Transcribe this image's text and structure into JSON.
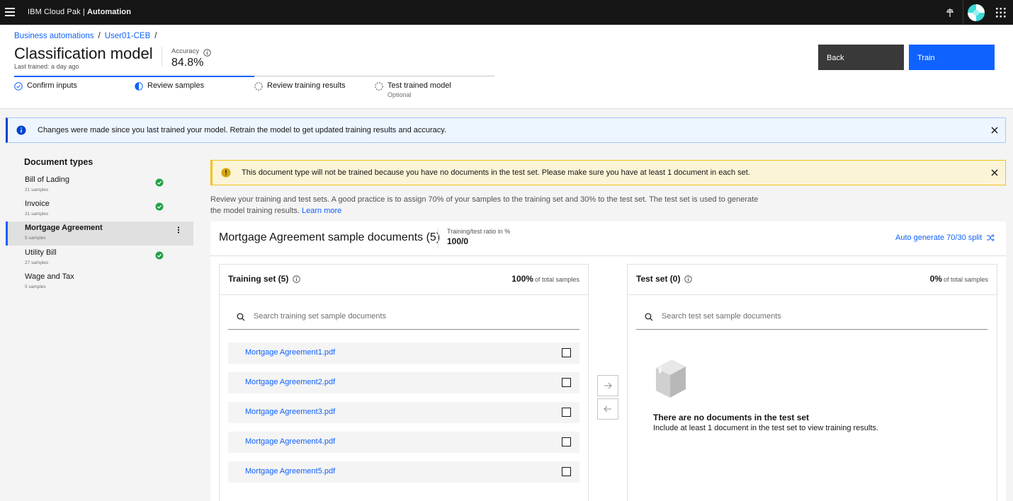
{
  "topbar": {
    "brand_prefix": "IBM Cloud Pak | ",
    "brand_product": "Automation",
    "icons": [
      "menu-icon",
      "pin-icon",
      "avatar",
      "app-switcher-icon"
    ]
  },
  "header": {
    "breadcrumbs": [
      "Business automations",
      "User01-CEB"
    ],
    "title": "Classification model",
    "last_trained": "Last trained: a day ago",
    "accuracy_label": "Accuracy",
    "accuracy_value": "84.8%",
    "steps": [
      {
        "label": "Confirm inputs",
        "state": "complete"
      },
      {
        "label": "Review samples",
        "state": "current"
      },
      {
        "label": "Review training results",
        "state": "incomplete"
      },
      {
        "label": "Test trained model",
        "state": "incomplete",
        "sub": "Optional"
      }
    ],
    "progress_fraction": 0.5,
    "back_label": "Back",
    "train_label": "Train"
  },
  "notice": {
    "text": "Changes were made since you last trained your model. Retrain the model to get updated training results and accuracy."
  },
  "sidebar": {
    "title": "Document types",
    "items": [
      {
        "name": "Bill of Lading",
        "count": "21 samples",
        "complete": true
      },
      {
        "name": "Invoice",
        "count": "31 samples",
        "complete": true
      },
      {
        "name": "Mortgage Agreement",
        "count": "5 samples",
        "complete": false,
        "active": true
      },
      {
        "name": "Utility Bill",
        "count": "27 samples",
        "complete": true
      },
      {
        "name": "Wage and Tax",
        "count": "5 samples",
        "complete": false
      }
    ]
  },
  "warning": {
    "text": "This document type will not be trained because you have no documents in the test set. Please make sure you have at least 1 document in each set."
  },
  "description": {
    "text": "Review your training and test sets. A good practice is to assign 70% of your samples to the training set and 30% to the test set. The test set is used to generate the model training results. ",
    "link": "Learn more"
  },
  "panel": {
    "title": "Mortgage Agreement sample documents (5)",
    "ratio_label": "Training/test ratio in %",
    "ratio_value": "100/0",
    "auto_split_label": "Auto generate 70/30 split"
  },
  "training_set": {
    "title": "Training set (5)",
    "percent": "100%",
    "percent_suffix": "of total samples",
    "search_placeholder": "Search training set sample documents",
    "files": [
      "Mortgage Agreement1.pdf",
      "Mortgage Agreement2.pdf",
      "Mortgage Agreement3.pdf",
      "Mortgage Agreement4.pdf",
      "Mortgage Agreement5.pdf"
    ]
  },
  "test_set": {
    "title": "Test set (0)",
    "percent": "0%",
    "percent_suffix": "of total samples",
    "search_placeholder": "Search test set sample documents",
    "empty_title": "There are no documents in the test set",
    "empty_sub": "Include at least 1 document in the test set to view training results."
  },
  "colors": {
    "accent": "#0f62fe",
    "success": "#24a148",
    "warning": "#f1c21b",
    "info": "#0043ce",
    "topbar": "#161616"
  }
}
